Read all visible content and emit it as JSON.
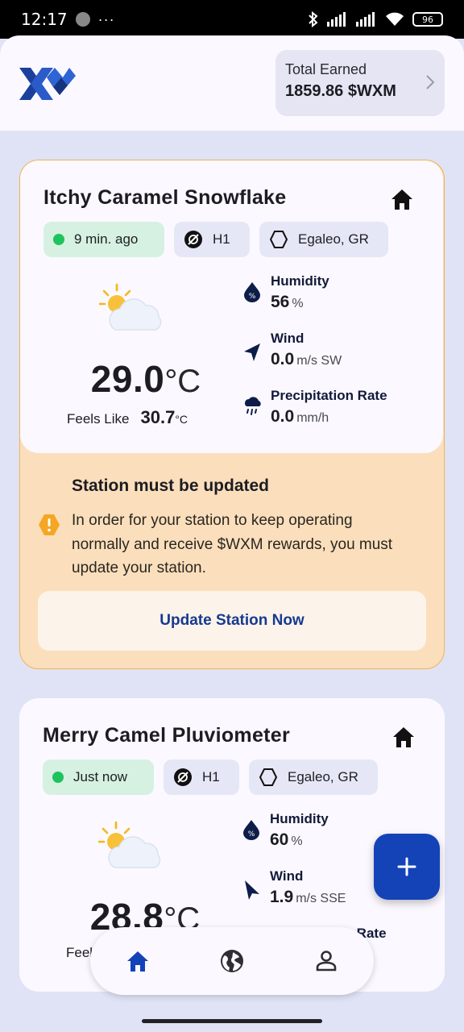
{
  "status_bar": {
    "time": "12:17",
    "dots": "···",
    "battery": "96"
  },
  "header": {
    "logo": "weatherxm-logo",
    "total_earned_label": "Total Earned",
    "total_earned_value": "1859.86 $WXM"
  },
  "stations": [
    {
      "name": "Itchy Caramel Snowflake",
      "last_seen": "9 min. ago",
      "model": "H1",
      "location": "Egaleo, GR",
      "temperature": "29.0",
      "temperature_unit": "°C",
      "feels_like_label": "Feels Like",
      "feels_like": "30.7",
      "feels_like_unit": "°C",
      "humidity_label": "Humidity",
      "humidity": "56",
      "humidity_unit": "%",
      "wind_label": "Wind",
      "wind": "0.0",
      "wind_unit": "m/s SW",
      "precip_label": "Precipitation Rate",
      "precip": "0.0",
      "precip_unit": "mm/h",
      "alert": {
        "title": "Station must be updated",
        "message": "In order for your station to keep operating normally and receive $WXM rewards, you must update your station.",
        "button": "Update Station Now"
      }
    },
    {
      "name": "Merry Camel Pluviometer",
      "last_seen": "Just now",
      "model": "H1",
      "location": "Egaleo, GR",
      "temperature": "28.8",
      "temperature_unit": "°C",
      "feels_like_label": "Feels Like",
      "humidity_label": "Humidity",
      "humidity": "60",
      "humidity_unit": "%",
      "wind_label": "Wind",
      "wind": "1.9",
      "wind_unit": "m/s SSE",
      "precip_label": "Precipitation Rate"
    }
  ],
  "colors": {
    "accent": "#1443b8",
    "online": "#1ec35e",
    "warning_bg": "#fbdfbc",
    "warning_icon": "#f5a623"
  },
  "nav": {
    "items": [
      "home-icon",
      "globe-icon",
      "profile-icon"
    ],
    "active": "home-icon"
  }
}
